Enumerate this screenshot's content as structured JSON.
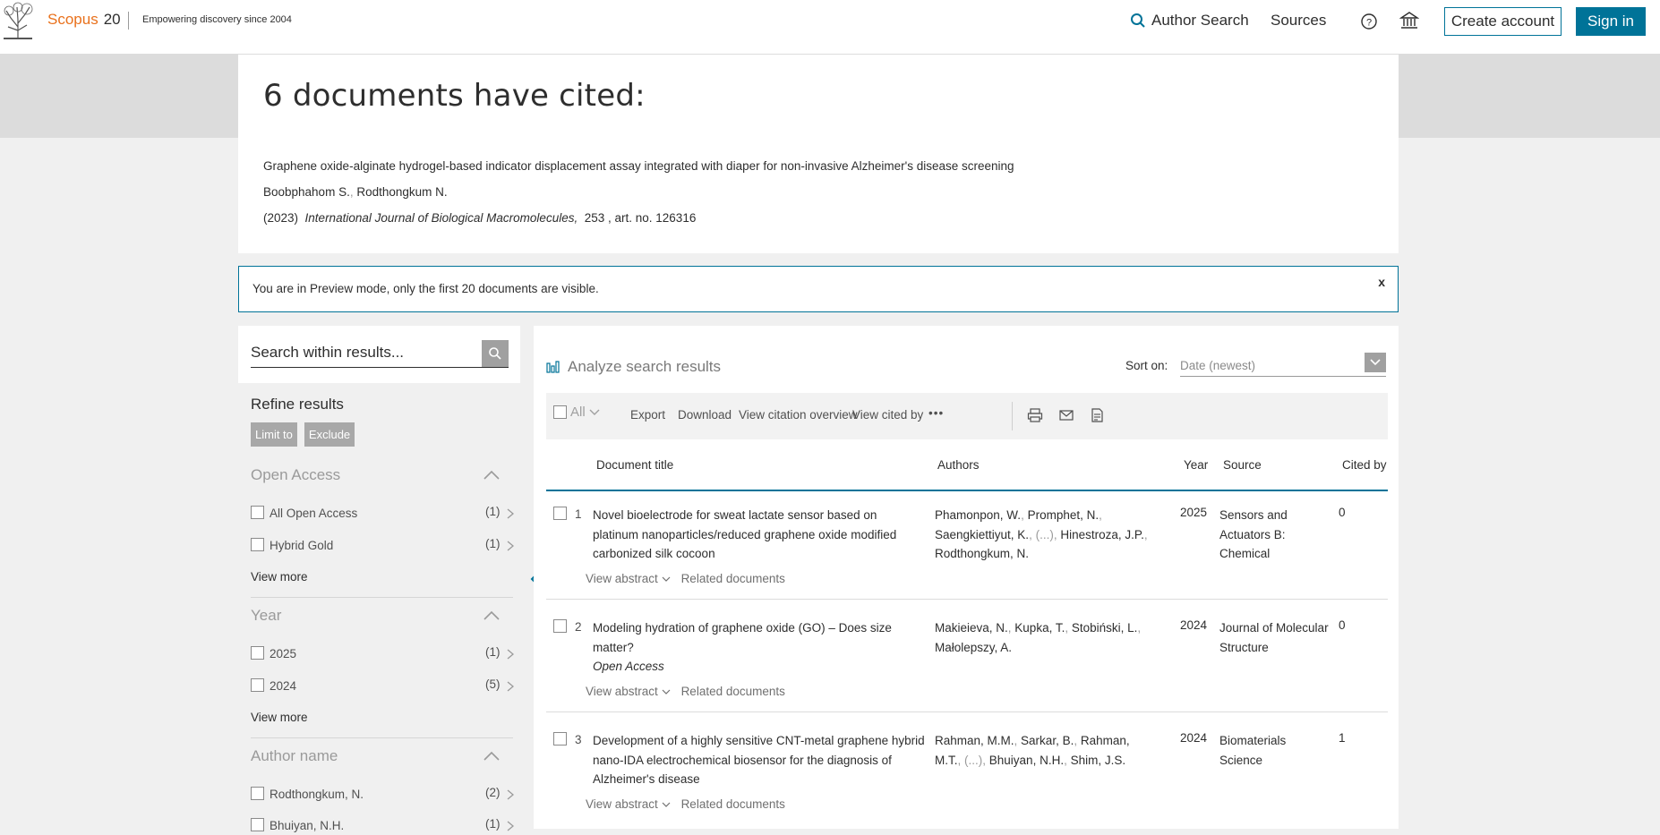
{
  "header": {
    "brand": "Scopus",
    "version": "20",
    "tagline": "Empowering discovery since 2004",
    "author_search": "Author Search",
    "sources": "Sources",
    "create_account": "Create account",
    "sign_in": "Sign in",
    "accent_color": "#007398",
    "brand_color": "#e9711c"
  },
  "cited": {
    "heading": "6 documents have cited:",
    "title": "Graphene oxide-alginate hydrogel-based indicator displacement assay integrated with diaper for non-invasive Alzheimer's disease screening",
    "author1": "Boobphahom S.",
    "author2": "Rodthongkum N.",
    "year": "(2023)",
    "journal": "International Journal of Biological Macromolecules,",
    "volume": "253 , art. no. 126316"
  },
  "preview": {
    "text": "You are in Preview mode, only the first 20 documents are visible.",
    "close": "x"
  },
  "search": {
    "placeholder": "Search within results..."
  },
  "refine": {
    "title": "Refine results",
    "limit_to": "Limit to",
    "exclude": "Exclude",
    "view_more": "View more",
    "facets": [
      {
        "name": "Open Access",
        "items": [
          {
            "label": "All Open Access",
            "count": "(1)"
          },
          {
            "label": "Hybrid Gold",
            "count": "(1)"
          }
        ]
      },
      {
        "name": "Year",
        "items": [
          {
            "label": "2025",
            "count": "(1)"
          },
          {
            "label": "2024",
            "count": "(5)"
          }
        ]
      },
      {
        "name": "Author name",
        "items": [
          {
            "label": "Rodthongkum, N.",
            "count": "(2)"
          },
          {
            "label": "Bhuiyan, N.H.",
            "count": "(1)"
          }
        ]
      }
    ]
  },
  "results": {
    "analyze": "Analyze search results",
    "sort_label": "Sort on:",
    "sort_value": "Date (newest)",
    "toolbar": {
      "all": "All",
      "export": "Export",
      "download": "Download",
      "citation_overview": "View citation overview",
      "view_cited_by": "View cited by",
      "more": "•••"
    },
    "columns": {
      "title": "Document title",
      "authors": "Authors",
      "year": "Year",
      "source": "Source",
      "cited_by": "Cited by"
    },
    "view_abstract": "View abstract",
    "related": "Related documents",
    "rows": [
      {
        "num": "1",
        "title": "Novel bioelectrode for sweat lactate sensor based on platinum nanoparticles/reduced graphene oxide modified carbonized silk cocoon",
        "oa": "",
        "a1": "Phamonpon, W.",
        "a2": "Promphet, N.",
        "a3": "Saengkiettiyut, K.",
        "ellipsis": "(...)",
        "a4": "Hinestroza, J.P.",
        "a5": "Rodthongkum, N.",
        "year": "2025",
        "source": "Sensors and Actuators B: Chemical",
        "cited_by": "0"
      },
      {
        "num": "2",
        "title": "Modeling hydration of graphene oxide (GO) – Does size matter?",
        "oa": "Open Access",
        "a1": "Makieieva, N.",
        "a2": "Kupka, T.",
        "a3": "Stobiński, L.",
        "a4": "Małolepszy, A.",
        "year": "2024",
        "source": "Journal of Molecular Structure",
        "cited_by": "0"
      },
      {
        "num": "3",
        "title": "Development of a highly sensitive CNT-metal graphene hybrid nano-IDA electrochemical biosensor for the diagnosis of Alzheimer's disease",
        "oa": "",
        "a1": "Rahman, M.M.",
        "a2": "Sarkar, B.",
        "a3": "Rahman, M.T.",
        "ellipsis": "(...)",
        "a4": "Bhuiyan, N.H.",
        "a5": "Shim, J.S.",
        "year": "2024",
        "source": "Biomaterials Science",
        "cited_by": "1"
      }
    ]
  }
}
